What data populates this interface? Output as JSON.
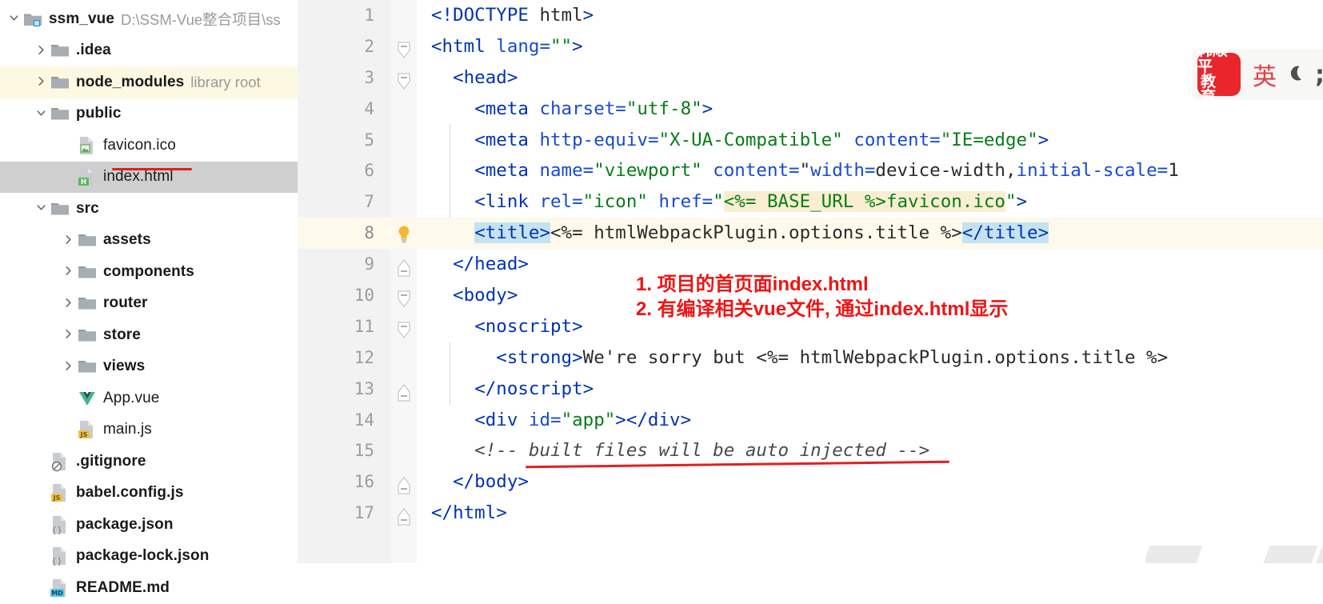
{
  "project_tree": {
    "root": {
      "label": "ssm_vue",
      "path": "D:\\SSM-Vue整合项目\\ss",
      "icon": "module-folder-icon",
      "arrow": "chevron-down"
    },
    "items": [
      {
        "label": ".idea",
        "sub": "",
        "depth": 1,
        "arrow": "chevron-right",
        "icon": "folder-icon",
        "highlight": ""
      },
      {
        "label": "node_modules",
        "sub": "library root",
        "depth": 1,
        "arrow": "chevron-right",
        "icon": "folder-icon",
        "highlight": "yellow"
      },
      {
        "label": "public",
        "sub": "",
        "depth": 1,
        "arrow": "chevron-down",
        "icon": "folder-icon",
        "highlight": ""
      },
      {
        "label": "favicon.ico",
        "sub": "",
        "depth": 2,
        "arrow": "none",
        "icon": "image-file-icon",
        "highlight": ""
      },
      {
        "label": "index.html",
        "sub": "",
        "depth": 2,
        "arrow": "none",
        "icon": "html-file-icon",
        "highlight": "gray"
      },
      {
        "label": "src",
        "sub": "",
        "depth": 1,
        "arrow": "chevron-down",
        "icon": "folder-icon",
        "highlight": ""
      },
      {
        "label": "assets",
        "sub": "",
        "depth": 2,
        "arrow": "chevron-right",
        "icon": "folder-icon",
        "highlight": ""
      },
      {
        "label": "components",
        "sub": "",
        "depth": 2,
        "arrow": "chevron-right",
        "icon": "folder-icon",
        "highlight": ""
      },
      {
        "label": "router",
        "sub": "",
        "depth": 2,
        "arrow": "chevron-right",
        "icon": "folder-icon",
        "highlight": ""
      },
      {
        "label": "store",
        "sub": "",
        "depth": 2,
        "arrow": "chevron-right",
        "icon": "folder-icon",
        "highlight": ""
      },
      {
        "label": "views",
        "sub": "",
        "depth": 2,
        "arrow": "chevron-right",
        "icon": "folder-icon",
        "highlight": ""
      },
      {
        "label": "App.vue",
        "sub": "",
        "depth": 2,
        "arrow": "none",
        "icon": "vue-file-icon",
        "highlight": ""
      },
      {
        "label": "main.js",
        "sub": "",
        "depth": 2,
        "arrow": "none",
        "icon": "js-file-icon",
        "highlight": ""
      },
      {
        "label": ".gitignore",
        "sub": "",
        "depth": 1,
        "arrow": "none",
        "icon": "gitignore-file-icon",
        "highlight": ""
      },
      {
        "label": "babel.config.js",
        "sub": "",
        "depth": 1,
        "arrow": "none",
        "icon": "js-file-icon",
        "highlight": ""
      },
      {
        "label": "package.json",
        "sub": "",
        "depth": 1,
        "arrow": "none",
        "icon": "json-file-icon",
        "highlight": ""
      },
      {
        "label": "package-lock.json",
        "sub": "",
        "depth": 1,
        "arrow": "none",
        "icon": "json-file-icon",
        "highlight": ""
      },
      {
        "label": "README.md",
        "sub": "",
        "depth": 1,
        "arrow": "none",
        "icon": "md-file-icon",
        "highlight": ""
      }
    ]
  },
  "editor": {
    "lines": [
      {
        "num": "1",
        "fold": "none",
        "highlighted": false
      },
      {
        "num": "2",
        "fold": "expanded",
        "highlighted": false
      },
      {
        "num": "3",
        "fold": "expanded",
        "highlighted": false
      },
      {
        "num": "4",
        "fold": "none",
        "highlighted": false
      },
      {
        "num": "5",
        "fold": "none",
        "highlighted": false
      },
      {
        "num": "6",
        "fold": "none",
        "highlighted": false
      },
      {
        "num": "7",
        "fold": "none",
        "highlighted": false
      },
      {
        "num": "8",
        "fold": "bulb",
        "highlighted": true
      },
      {
        "num": "9",
        "fold": "collapse-end",
        "highlighted": false
      },
      {
        "num": "10",
        "fold": "expanded",
        "highlighted": false
      },
      {
        "num": "11",
        "fold": "expanded",
        "highlighted": false
      },
      {
        "num": "12",
        "fold": "none",
        "highlighted": false
      },
      {
        "num": "13",
        "fold": "collapse-end",
        "highlighted": false
      },
      {
        "num": "14",
        "fold": "none",
        "highlighted": false
      },
      {
        "num": "15",
        "fold": "none",
        "highlighted": false
      },
      {
        "num": "16",
        "fold": "collapse-end",
        "highlighted": false
      },
      {
        "num": "17",
        "fold": "collapse-end",
        "highlighted": false
      }
    ],
    "code_text": [
      "<!DOCTYPE html>",
      "<html lang=\"\">",
      "  <head>",
      "    <meta charset=\"utf-8\">",
      "    <meta http-equiv=\"X-UA-Compatible\" content=\"IE=edge\">",
      "    <meta name=\"viewport\" content=\"width=device-width,initial-scale=1",
      "    <link rel=\"icon\" href=\"<%= BASE_URL %>favicon.ico\">",
      "    <title><%= htmlWebpackPlugin.options.title %></title>",
      "  </head>",
      "  <body>",
      "    <noscript>",
      "      <strong>We're sorry but <%= htmlWebpackPlugin.options.title %>",
      "    </noscript>",
      "    <div id=\"app\"></div>",
      "    <!-- built files will be auto injected -->",
      "  </body>",
      "</html>"
    ]
  },
  "annotations": {
    "note_line1": "1. 项目的首页面index.html",
    "note_line2": "2. 有编译相关vue文件, 通过index.html显示"
  },
  "ime_bar": {
    "logo_line1": "韩顺平",
    "logo_line2": "教 育",
    "mode_label": "英",
    "icons": [
      "moon-icon",
      "semicolon-icon",
      "keyboard-icon",
      "skin-icon",
      "wrench-icon"
    ]
  },
  "colors": {
    "accent_red": "#e02020",
    "tag_blue": "#0033b3",
    "string_green": "#067d17",
    "ime_red": "#e8262b",
    "selection_gray": "#cfcfcf",
    "highlight_yellow": "#fdf8e2"
  }
}
